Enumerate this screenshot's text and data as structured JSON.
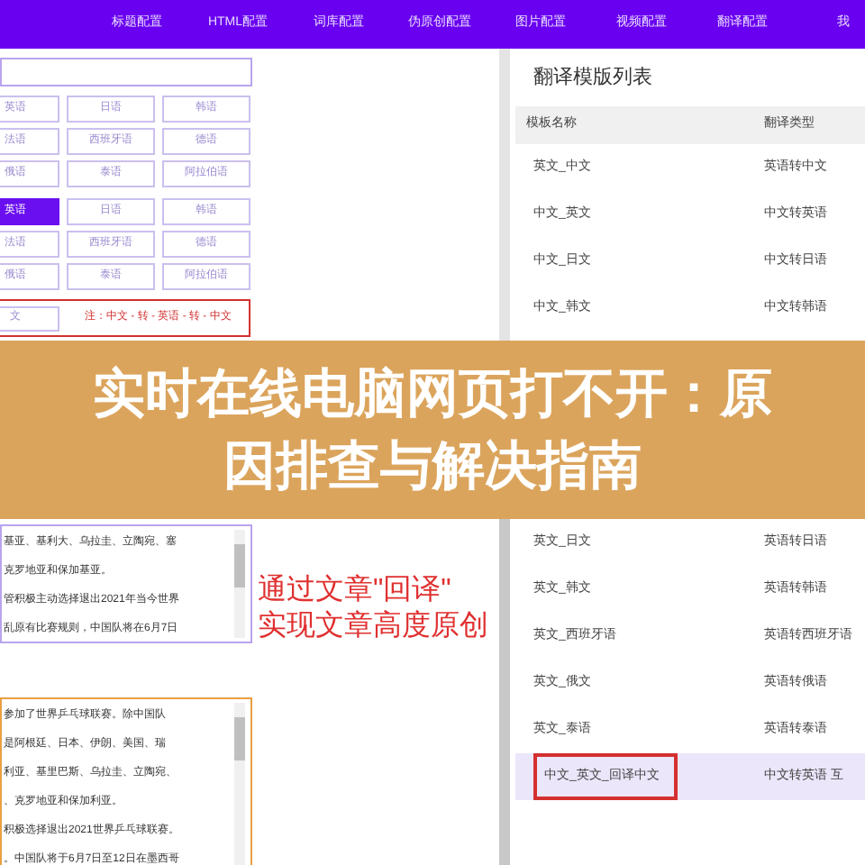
{
  "nav": {
    "items": [
      "标题配置",
      "HTML配置",
      "词库配置",
      "伪原创配置",
      "图片配置",
      "视频配置",
      "翻译配置",
      "我"
    ]
  },
  "source_languages": [
    {
      "label": "英语",
      "selected": false
    },
    {
      "label": "日语",
      "selected": false
    },
    {
      "label": "韩语",
      "selected": false
    },
    {
      "label": "法语",
      "selected": false
    },
    {
      "label": "西班牙语",
      "selected": false
    },
    {
      "label": "德语",
      "selected": false
    },
    {
      "label": "俄语",
      "selected": false
    },
    {
      "label": "泰语",
      "selected": false
    },
    {
      "label": "阿拉伯语",
      "selected": false
    }
  ],
  "target_languages": [
    {
      "label": "英语",
      "selected": true
    },
    {
      "label": "日语",
      "selected": false
    },
    {
      "label": "韩语",
      "selected": false
    },
    {
      "label": "法语",
      "selected": false
    },
    {
      "label": "西班牙语",
      "selected": false
    },
    {
      "label": "德语",
      "selected": false
    },
    {
      "label": "俄语",
      "selected": false
    },
    {
      "label": "泰语",
      "selected": false
    },
    {
      "label": "阿拉伯语",
      "selected": false
    }
  ],
  "note_box": {
    "button": "文",
    "note": "注：中文 - 转 - 英语 - 转 - 中文"
  },
  "banner": {
    "lines": [
      "实时在线电脑网页打不开：原",
      "因排查与解决指南"
    ]
  },
  "textareas": [
    {
      "focused": false,
      "lines": [
        "基亚、基利大、乌拉圭、立陶宛、塞",
        "克罗地亚和保加基亚。",
        "管积极主动选择退出2021年当今世界",
        "乱原有比赛规则，中国队将在6月7日"
      ]
    },
    {
      "focused": true,
      "lines": [
        "参加了世界乒乓球联赛。除中国队",
        "是阿根廷、日本、伊朗、美国、瑞",
        "利亚、基里巴斯、乌拉圭、立陶宛、",
        "、克罗地亚和保加利亚。",
        "积极选择退出2021世界乒乓球联赛。",
        "。中国队将于6月7日至12日在墨西哥"
      ]
    }
  ],
  "callout": {
    "lines": [
      "通过文章\"回译\"",
      "实现文章高度原创"
    ]
  },
  "template_panel": {
    "title": "翻译模版列表",
    "columns": [
      "模板名称",
      "翻译类型"
    ],
    "rows_top": [
      {
        "name": "英文_中文",
        "type": "英语转中文",
        "selected": false
      },
      {
        "name": "中文_英文",
        "type": "中文转英语",
        "selected": false
      },
      {
        "name": "中文_日文",
        "type": "中文转日语",
        "selected": false
      },
      {
        "name": "中文_韩文",
        "type": "中文转韩语",
        "selected": false
      }
    ],
    "rows_bottom": [
      {
        "name": "英文_日文",
        "type": "英语转日语",
        "selected": false
      },
      {
        "name": "英文_韩文",
        "type": "英语转韩语",
        "selected": false
      },
      {
        "name": "英文_西班牙语",
        "type": "英语转西班牙语",
        "selected": false
      },
      {
        "name": "英文_俄文",
        "type": "英语转俄语",
        "selected": false
      },
      {
        "name": "英文_泰语",
        "type": "英语转泰语",
        "selected": false
      },
      {
        "name": "中文_英文_回译中文",
        "type": "中文转英语 互",
        "selected": true
      }
    ]
  }
}
